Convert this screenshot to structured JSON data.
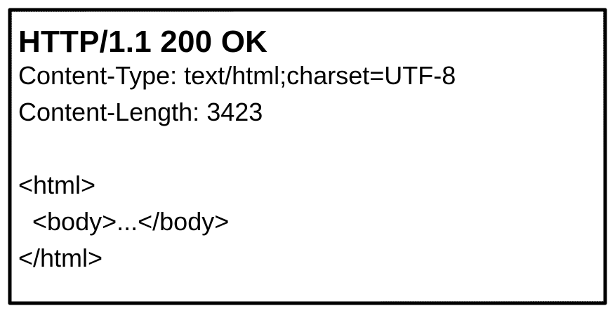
{
  "response": {
    "status_line": "HTTP/1.1 200 OK",
    "headers": [
      "Content-Type: text/html;charset=UTF-8",
      "Content-Length: 3423"
    ],
    "body_lines": [
      "<html>",
      "  <body>...</body>",
      "</html>"
    ]
  },
  "colors": {
    "border": "#000000",
    "text": "#000000",
    "background": "#ffffff"
  }
}
